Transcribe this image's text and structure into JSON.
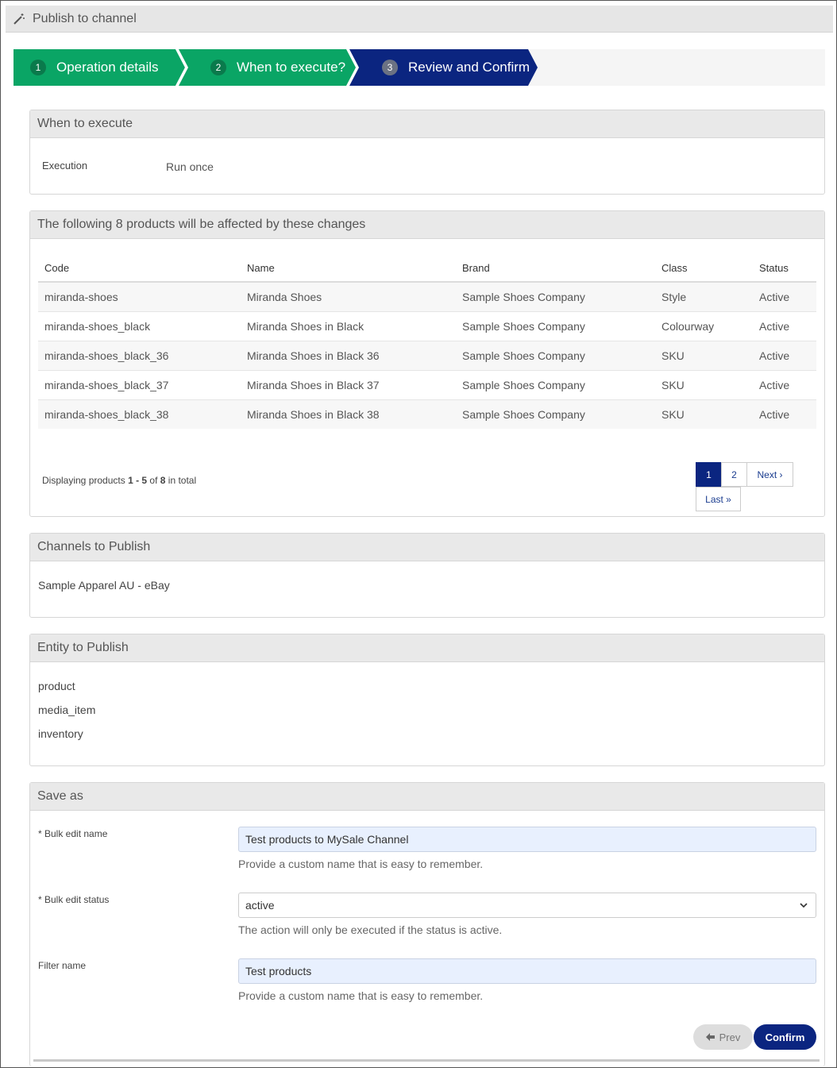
{
  "window": {
    "title": "Publish to channel",
    "icon": "magic-wand-icon"
  },
  "colors": {
    "step_done": "#0aa565",
    "step_active": "#0b2580",
    "accent": "#0b2580"
  },
  "steps": [
    {
      "number": "1",
      "label": "Operation details",
      "state": "done"
    },
    {
      "number": "2",
      "label": "When to execute?",
      "state": "done"
    },
    {
      "number": "3",
      "label": "Review and Confirm",
      "state": "active"
    }
  ],
  "when": {
    "title": "When to execute",
    "execution_label": "Execution",
    "execution_value": "Run once"
  },
  "products": {
    "title": "The following 8 products will be affected by these changes",
    "columns": [
      "Code",
      "Name",
      "Brand",
      "Class",
      "Status"
    ],
    "rows": [
      [
        "miranda-shoes",
        "Miranda Shoes",
        "Sample Shoes Company",
        "Style",
        "Active"
      ],
      [
        "miranda-shoes_black",
        "Miranda Shoes in Black",
        "Sample Shoes Company",
        "Colourway",
        "Active"
      ],
      [
        "miranda-shoes_black_36",
        "Miranda Shoes in Black 36",
        "Sample Shoes Company",
        "SKU",
        "Active"
      ],
      [
        "miranda-shoes_black_37",
        "Miranda Shoes in Black 37",
        "Sample Shoes Company",
        "SKU",
        "Active"
      ],
      [
        "miranda-shoes_black_38",
        "Miranda Shoes in Black 38",
        "Sample Shoes Company",
        "SKU",
        "Active"
      ]
    ],
    "summary": {
      "prefix": "Displaying products ",
      "range": "1 - 5",
      "of": " of ",
      "total": "8",
      "suffix": " in total"
    },
    "pager": {
      "page1": "1",
      "page2": "2",
      "next": "Next ›",
      "last": "Last »",
      "current": "1"
    }
  },
  "channels": {
    "title": "Channels to Publish",
    "items": [
      "Sample Apparel AU - eBay"
    ]
  },
  "entities": {
    "title": "Entity to Publish",
    "items": [
      "product",
      "media_item",
      "inventory"
    ]
  },
  "save": {
    "title": "Save as",
    "name_label": "* Bulk edit name",
    "name_value": "Test products to MySale Channel",
    "name_help": "Provide a custom name that is easy to remember.",
    "status_label": "* Bulk edit status",
    "status_value": "active",
    "status_help": "The action will only be executed if the status is active.",
    "filter_label": "Filter name",
    "filter_value": "Test products",
    "filter_help": "Provide a custom name that is easy to remember.",
    "prev_label": "Prev",
    "confirm_label": "Confirm"
  }
}
